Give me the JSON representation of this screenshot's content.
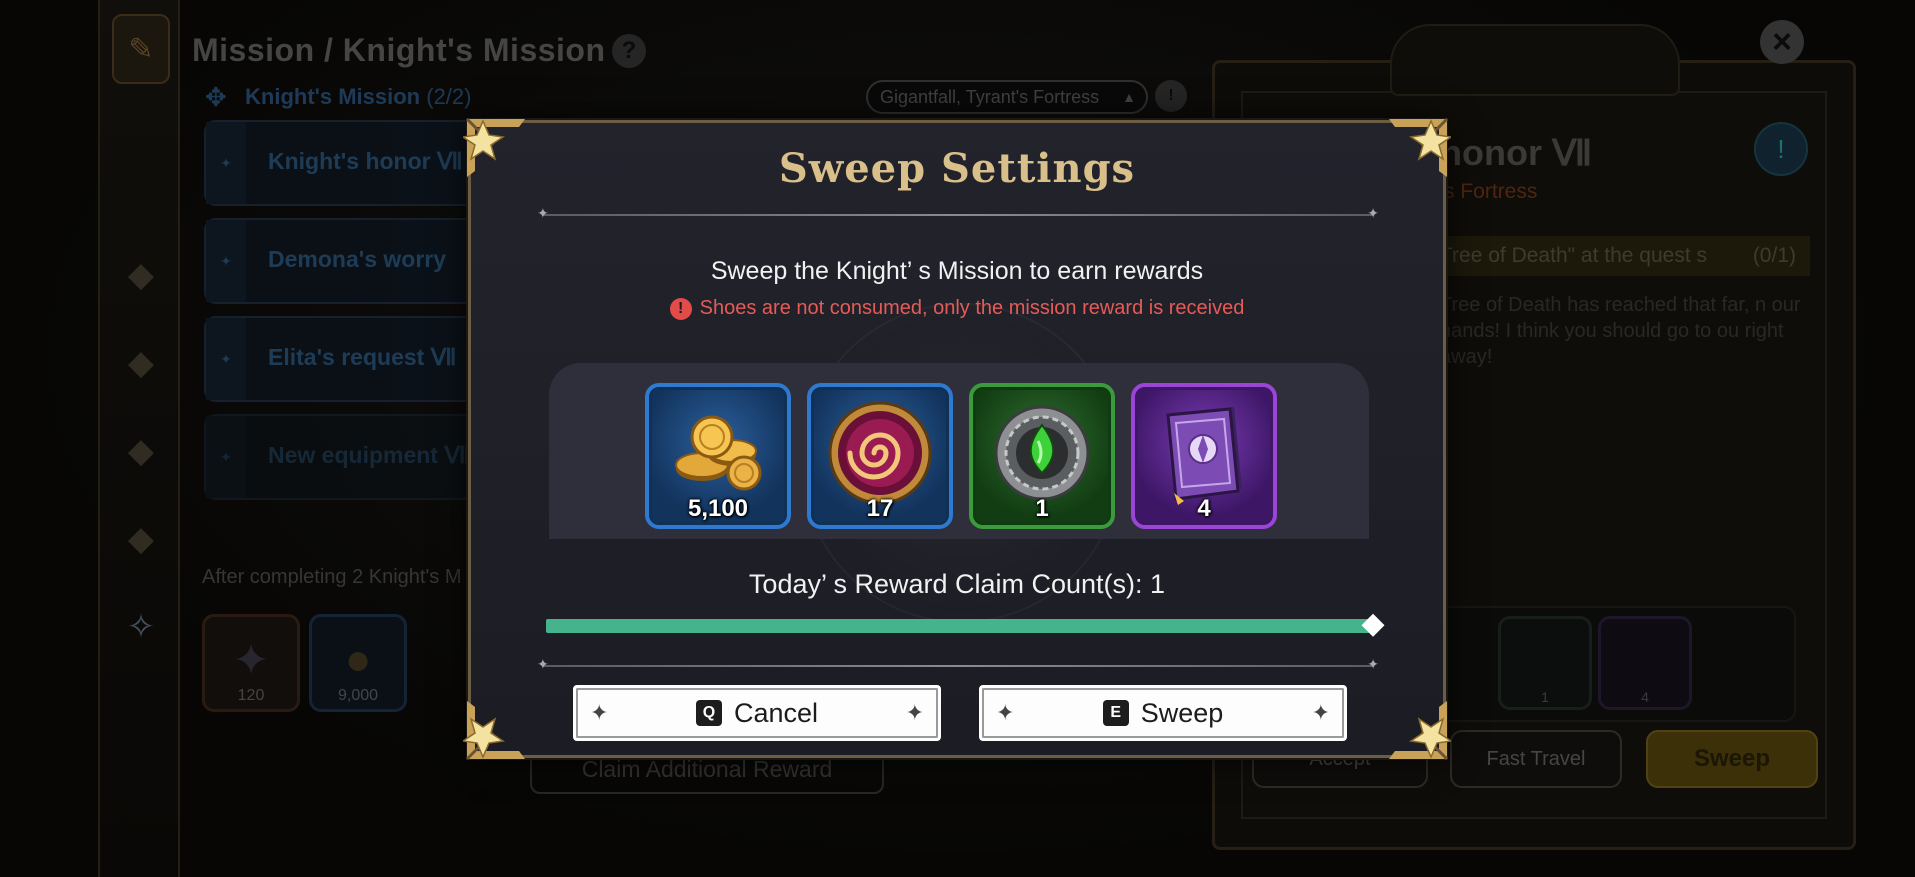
{
  "background": {
    "title": "Mission / Knight's Mission",
    "help_label": "?",
    "subheader_icon": "diamond-compass-icon",
    "subheader_label": "Knight's Mission",
    "subheader_count": "(2/2)",
    "region_selected": "Gigantfall, Tyrant's Fortress",
    "missions": [
      {
        "label": "Knight's honor Ⅶ"
      },
      {
        "label": "Demona's worry"
      },
      {
        "label": "Elita's request Ⅶ"
      },
      {
        "label": "New equipment Ⅶ"
      }
    ],
    "after_text": "After completing 2 Knight's M",
    "left_rewards": [
      {
        "icon": "purple-crystal-icon",
        "count": "120"
      },
      {
        "icon": "gold-coins-icon",
        "count": "9,000"
      }
    ],
    "claim_additional_label": "Claim Additional Reward",
    "close_label": "×",
    "quest": {
      "title": "honor Ⅶ",
      "location": "'s Fortress",
      "objective": "Tree of Death\"  at the quest s",
      "objective_count": "(0/1)",
      "description": "Tree of Death has reached that far, n our hands! I think you should go to ou right away!",
      "reward_counts": [
        "1",
        "4"
      ],
      "accept_label": "Accept",
      "fast_travel_label": "Fast Travel",
      "sweep_label": "Sweep"
    }
  },
  "modal": {
    "title": "Sweep Settings",
    "description": "Sweep the Knight’ s Mission to earn rewards",
    "warning": "Shoes are not consumed, only the mission reward is received",
    "warning_icon": "!",
    "rewards": [
      {
        "icon": "gold-coins-icon",
        "count": "5,100",
        "frame": "blue"
      },
      {
        "icon": "pink-swirl-orb-icon",
        "count": "17",
        "frame": "blue"
      },
      {
        "icon": "green-gem-medallion-icon",
        "count": "1",
        "frame": "green"
      },
      {
        "icon": "purple-spellbook-icon",
        "count": "4",
        "frame": "purple"
      }
    ],
    "claim_count_label": "Today’ s Reward Claim Count(s): 1",
    "progress_fraction": 1.0,
    "cancel": {
      "key": "Q",
      "label": "Cancel"
    },
    "sweep": {
      "key": "E",
      "label": "Sweep"
    }
  },
  "colors": {
    "title_gold": "#d9c08a",
    "warning_red": "#e55b57",
    "progress_green": "#45b48c",
    "frame_blue": "#2d7ad0",
    "frame_green": "#3b9a3b",
    "frame_purple": "#9a45d6"
  }
}
